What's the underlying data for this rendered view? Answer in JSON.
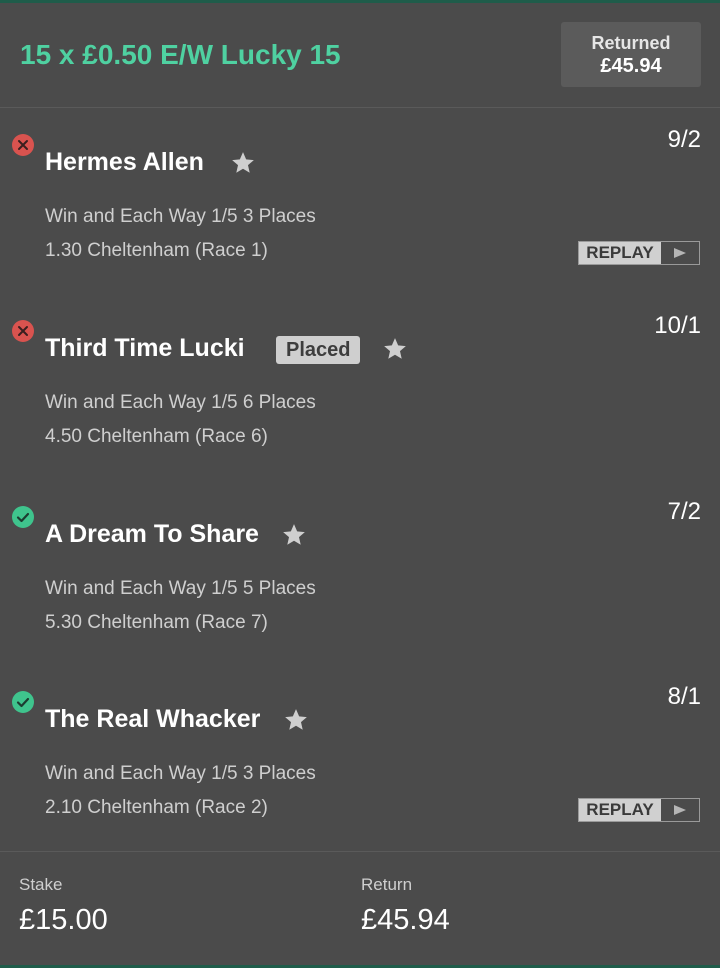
{
  "header": {
    "bet_title": "15 x £0.50 E/W Lucky 15",
    "returned_label": "Returned",
    "returned_value": "£45.94"
  },
  "selections": [
    {
      "status": "lost",
      "runner": "Hermes Allen",
      "badge": "",
      "odds": "9/2",
      "market": "Win and Each Way 1/5 3 Places",
      "event": "1.30 Cheltenham (Race 1)",
      "replay": "REPLAY"
    },
    {
      "status": "lost",
      "runner": "Third Time Lucki",
      "badge": "Placed",
      "odds": "10/1",
      "market": "Win and Each Way 1/5 6 Places",
      "event": "4.50 Cheltenham (Race 6)",
      "replay": ""
    },
    {
      "status": "won",
      "runner": "A Dream To Share",
      "badge": "",
      "odds": "7/2",
      "market": "Win and Each Way 1/5 5 Places",
      "event": "5.30 Cheltenham (Race 7)",
      "replay": ""
    },
    {
      "status": "won",
      "runner": "The Real Whacker",
      "badge": "",
      "odds": "8/1",
      "market": "Win and Each Way 1/5 3 Places",
      "event": "2.10 Cheltenham (Race 2)",
      "replay": "REPLAY"
    }
  ],
  "footer": {
    "stake_label": "Stake",
    "stake_value": "£15.00",
    "return_label": "Return",
    "return_value": "£45.94"
  },
  "colors": {
    "accent": "#4fd1a1",
    "lost": "#d9534f",
    "won": "#3fc48d",
    "background": "#4b4b4b"
  },
  "icons": {
    "lost": "cross-circle-icon",
    "won": "check-circle-icon",
    "favourite": "star-icon",
    "replay": "play-triangle-icon"
  }
}
